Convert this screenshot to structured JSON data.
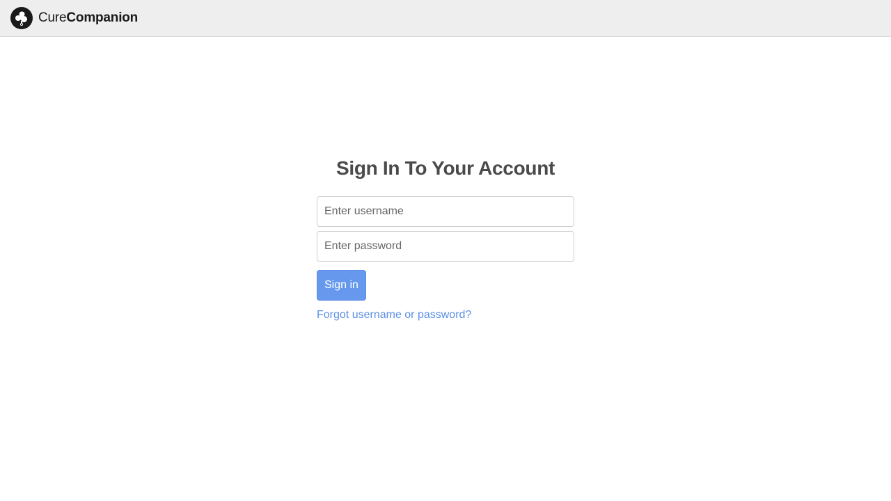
{
  "header": {
    "brand": {
      "name_light": "Cure",
      "name_bold": "Companion",
      "logo_icon": "cure-companion-logo-icon"
    }
  },
  "signin": {
    "title": "Sign In To Your Account",
    "username": {
      "value": "",
      "placeholder": "Enter username"
    },
    "password": {
      "value": "",
      "placeholder": "Enter password"
    },
    "submit_label": "Sign in",
    "forgot_label": "Forgot username or password?"
  },
  "colors": {
    "topbar_bg": "#eeeeee",
    "title": "#4a4a4a",
    "primary_button": "#6699ee",
    "link": "#5b8fe6",
    "logo": "#1a1a1a"
  }
}
